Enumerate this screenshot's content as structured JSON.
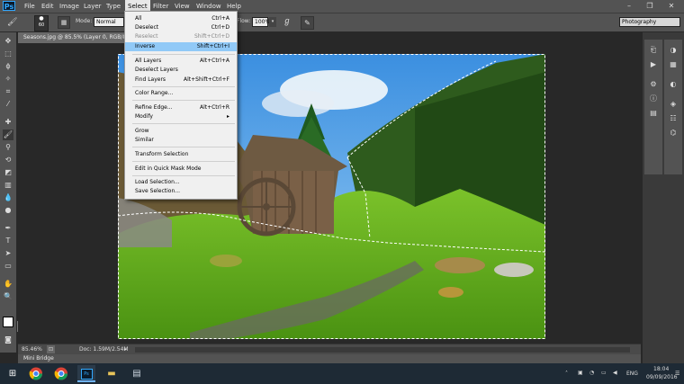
{
  "menubar": {
    "logo": "Ps",
    "items": [
      "File",
      "Edit",
      "Image",
      "Layer",
      "Type",
      "Select",
      "Filter",
      "View",
      "Window",
      "Help"
    ],
    "window_controls": [
      "–",
      "❐",
      "✕"
    ]
  },
  "options": {
    "brush_size": "60",
    "mode_label": "Mode:",
    "mode_value": "Normal",
    "flow_label": "Flow:",
    "flow_value": "100%",
    "workspace": "Photography"
  },
  "document": {
    "tab_title": "Seasons.jpg @ 85.5% (Layer 0, RGB/8#)",
    "zoom": "85.46%",
    "doc_info": "Doc: 1.59M/2.54M"
  },
  "panels": {
    "mini_bridge": "Mini Bridge"
  },
  "select_menu": {
    "items": [
      {
        "label": "All",
        "shortcut": "Ctrl+A"
      },
      {
        "label": "Deselect",
        "shortcut": "Ctrl+D"
      },
      {
        "label": "Reselect",
        "shortcut": "Shift+Ctrl+D"
      },
      {
        "label": "Inverse",
        "shortcut": "Shift+Ctrl+I"
      },
      {
        "label": "All Layers",
        "shortcut": "Alt+Ctrl+A"
      },
      {
        "label": "Deselect Layers",
        "shortcut": ""
      },
      {
        "label": "Find Layers",
        "shortcut": "Alt+Shift+Ctrl+F"
      },
      {
        "label": "Color Range...",
        "shortcut": ""
      },
      {
        "label": "Refine Edge...",
        "shortcut": "Alt+Ctrl+R"
      },
      {
        "label": "Modify",
        "shortcut": "▸"
      },
      {
        "label": "Grow",
        "shortcut": ""
      },
      {
        "label": "Similar",
        "shortcut": ""
      },
      {
        "label": "Transform Selection",
        "shortcut": ""
      },
      {
        "label": "Edit in Quick Mask Mode",
        "shortcut": ""
      },
      {
        "label": "Load Selection...",
        "shortcut": ""
      },
      {
        "label": "Save Selection...",
        "shortcut": ""
      }
    ]
  },
  "taskbar": {
    "language": "ENG",
    "time": "18:04",
    "date": "09/09/2016"
  },
  "colors": {
    "ps_blue": "#31a8ff",
    "menu_highlight": "#91c9f7",
    "chrome": "#535353"
  }
}
